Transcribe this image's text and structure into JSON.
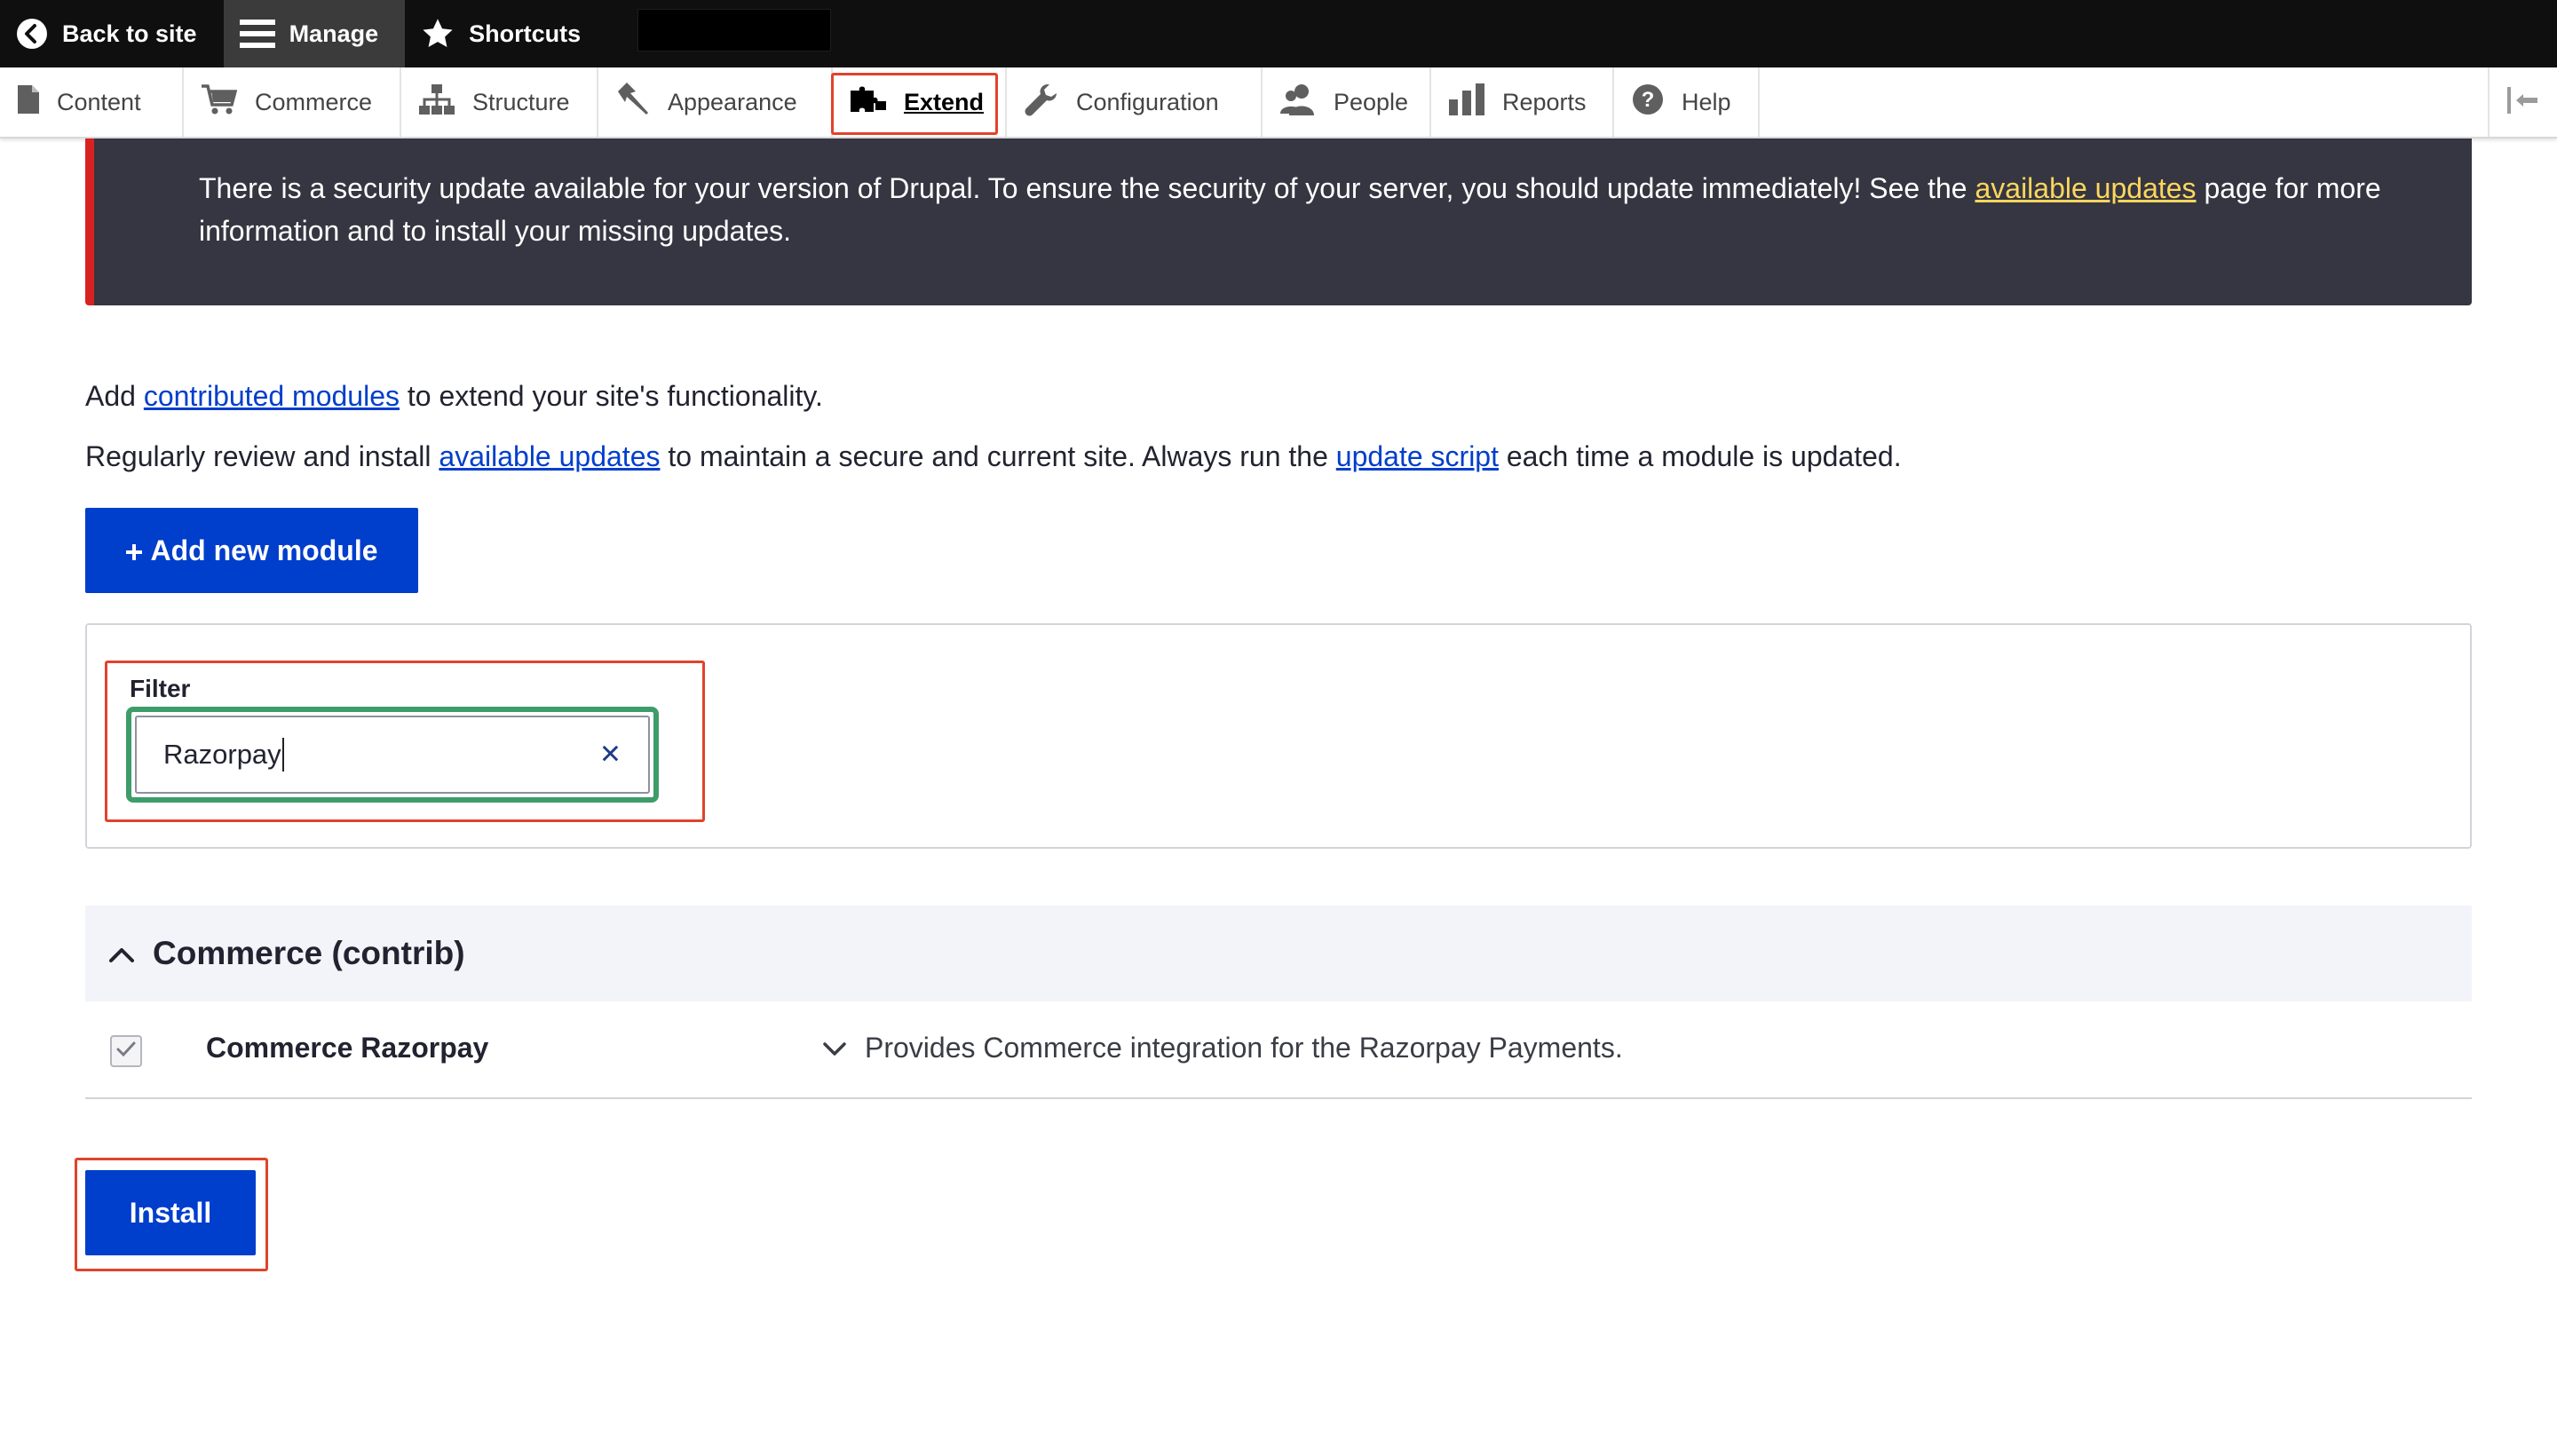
{
  "toolbar": {
    "back_label": "Back to site",
    "manage_label": "Manage",
    "shortcuts_label": "Shortcuts",
    "redacted_username": ""
  },
  "tray": {
    "items": [
      {
        "label": "Content",
        "icon": "file-icon"
      },
      {
        "label": "Commerce",
        "icon": "cart-icon"
      },
      {
        "label": "Structure",
        "icon": "sitemap-icon"
      },
      {
        "label": "Appearance",
        "icon": "paintbrush-icon"
      },
      {
        "label": "Extend",
        "icon": "puzzle-icon",
        "active": true
      },
      {
        "label": "Configuration",
        "icon": "wrench-icon"
      },
      {
        "label": "People",
        "icon": "people-icon"
      },
      {
        "label": "Reports",
        "icon": "bar-chart-icon"
      },
      {
        "label": "Help",
        "icon": "help-icon"
      }
    ]
  },
  "message": {
    "text_before": "There is a security update available for your version of Drupal. To ensure the security of your server, you should update immediately! See the ",
    "link": "available updates",
    "text_after": " page for more information and to install your missing updates."
  },
  "intro": {
    "p1_before": "Add ",
    "p1_link": "contributed modules",
    "p1_after": " to extend your site's functionality.",
    "p2_before": "Regularly review and install ",
    "p2_link1": "available updates",
    "p2_mid": " to maintain a secure and current site. Always run the ",
    "p2_link2": "update script",
    "p2_after": " each time a module is updated."
  },
  "add_module_button": "Add new module",
  "filter": {
    "label": "Filter",
    "value": "Razorpay",
    "clear_glyph": "✕"
  },
  "package": {
    "title": "Commerce (contrib)",
    "modules": [
      {
        "name": "Commerce Razorpay",
        "description": "Provides Commerce integration for the Razorpay Payments.",
        "checked": true
      }
    ]
  },
  "install_button": "Install",
  "colors": {
    "primary": "#003ecc",
    "message_bg": "#353641",
    "message_border": "#d72222",
    "link_yellow": "#fdd65e",
    "highlight_red": "#e0432b",
    "focus_green": "#3e9c6a"
  }
}
